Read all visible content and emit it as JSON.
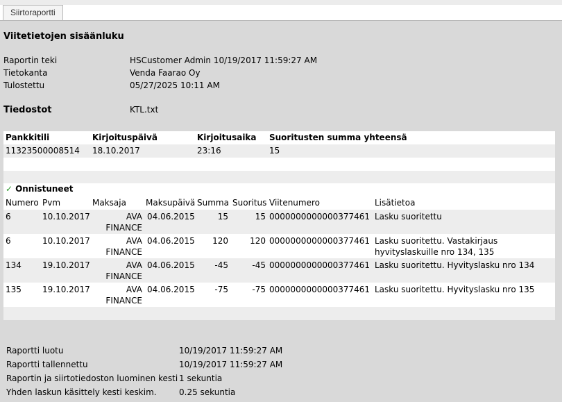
{
  "tab": {
    "label": "Siirtoraportti"
  },
  "title": "Viitetietojen sisäänluku",
  "info": [
    {
      "label": "Raportin teki",
      "value": "HSCustomer Admin 10/19/2017 11:59:27 AM"
    },
    {
      "label": "Tietokanta",
      "value": "Venda Faarao Oy"
    },
    {
      "label": "Tulostettu",
      "value": "05/27/2025 10:11 AM"
    }
  ],
  "files": {
    "label": "Tiedostot",
    "value": "KTL.txt"
  },
  "summary": {
    "headers": [
      "Pankkitili",
      "Kirjoituspäivä",
      "Kirjoitusaika",
      "Suoritusten summa yhteensä"
    ],
    "row": [
      "11323500008514",
      "18.10.2017",
      "23:16",
      "15"
    ]
  },
  "success": {
    "label": "Onnistuneet",
    "headers": [
      "Numero",
      "Pvm",
      "Maksaja",
      "Maksupäivä",
      "Summa",
      "Suoritus",
      "Viitenumero",
      "Lisätietoa"
    ],
    "rows": [
      {
        "numero": "6",
        "pvm": "10.10.2017",
        "maksaja1": "AVA",
        "maksaja2": "FINANCE",
        "maksupaiva": "04.06.2015",
        "summa": "15",
        "suoritus": "15",
        "viite": "0000000000000377461",
        "lisa1": "Lasku suoritettu",
        "lisa2": ""
      },
      {
        "numero": "6",
        "pvm": "10.10.2017",
        "maksaja1": "AVA",
        "maksaja2": "FINANCE",
        "maksupaiva": "04.06.2015",
        "summa": "120",
        "suoritus": "120",
        "viite": "0000000000000377461",
        "lisa1": "Lasku suoritettu. Vastakirjaus",
        "lisa2": "hyvityslaskuille nro 134, 135"
      },
      {
        "numero": "134",
        "pvm": "19.10.2017",
        "maksaja1": "AVA",
        "maksaja2": "FINANCE",
        "maksupaiva": "04.06.2015",
        "summa": "-45",
        "suoritus": "-45",
        "viite": "0000000000000377461",
        "lisa1": "Lasku suoritettu. Hyvityslasku nro 134",
        "lisa2": ""
      },
      {
        "numero": "135",
        "pvm": "19.10.2017",
        "maksaja1": "AVA",
        "maksaja2": "FINANCE",
        "maksupaiva": "04.06.2015",
        "summa": "-75",
        "suoritus": "-75",
        "viite": "0000000000000377461",
        "lisa1": "Lasku suoritettu. Hyvityslasku nro 135",
        "lisa2": ""
      }
    ]
  },
  "footer": [
    {
      "label": "Raportti luotu",
      "value": "10/19/2017 11:59:27 AM"
    },
    {
      "label": "Raportti tallennettu",
      "value": "10/19/2017 11:59:27 AM"
    },
    {
      "label": "Raportin ja siirtotiedoston luominen kesti",
      "value": "1 sekuntia"
    },
    {
      "label": "Yhden laskun käsittely kesti keskim.",
      "value": "0.25 sekuntia"
    }
  ],
  "colors": {
    "background": "#d9d9d9",
    "panel": "#ffffff",
    "row_alt": "#ededed",
    "check": "#2e9a2e"
  }
}
